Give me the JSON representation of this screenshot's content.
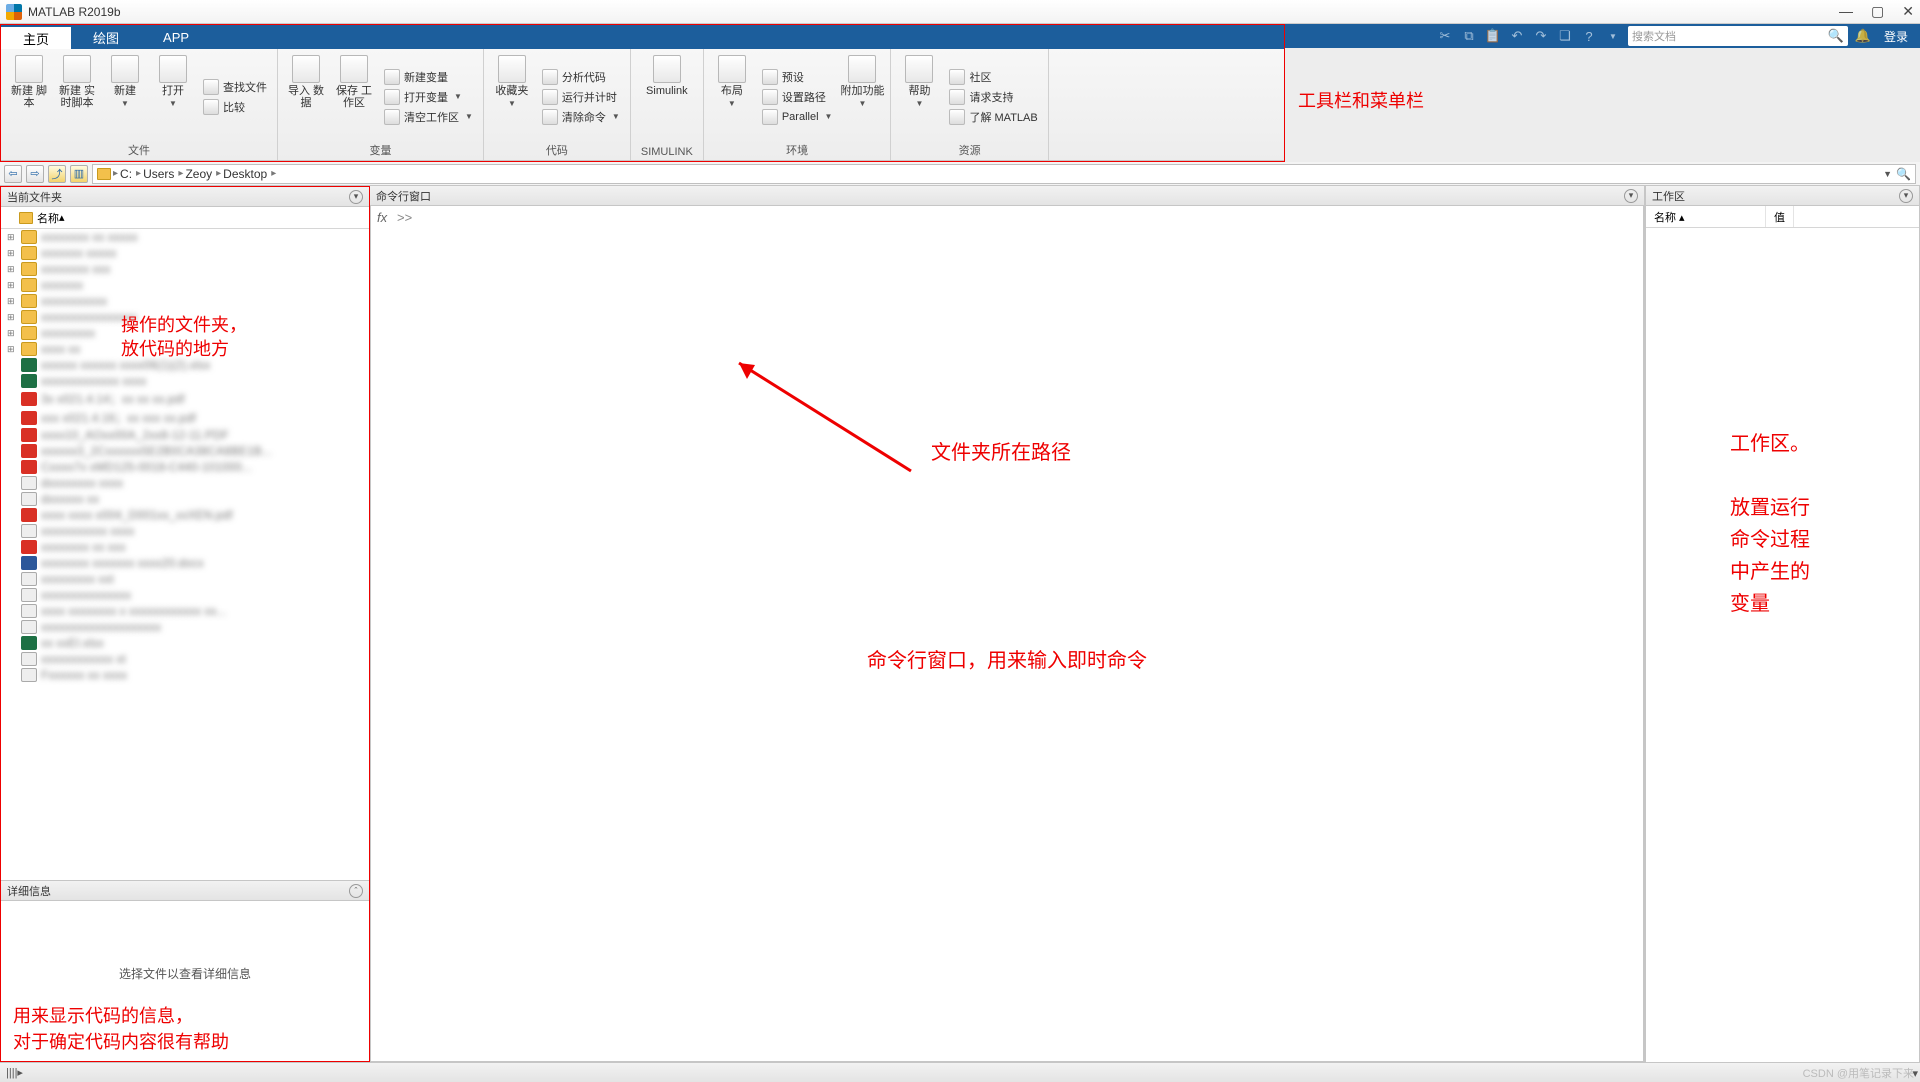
{
  "title": "MATLAB R2019b",
  "window": {
    "min": "—",
    "max": "▢",
    "close": "✕"
  },
  "tabs": [
    {
      "label": "主页",
      "active": true
    },
    {
      "label": "绘图",
      "active": false
    },
    {
      "label": "APP",
      "active": false
    }
  ],
  "search": {
    "placeholder": "搜索文档"
  },
  "login": "登录",
  "ribbon": {
    "groups": {
      "file": {
        "label": "文件",
        "items": {
          "newscript": "新建\n脚本",
          "newlive": "新建\n实时脚本",
          "new": "新建",
          "open": "打开",
          "findfiles": "查找文件",
          "compare": "比较"
        }
      },
      "variable": {
        "label": "变量",
        "items": {
          "import": "导入\n数据",
          "savews": "保存\n工作区",
          "newvar": "新建变量",
          "openvar": "打开变量",
          "clearws": "清空工作区"
        }
      },
      "code": {
        "label": "代码",
        "items": {
          "fav": "收藏夹",
          "analyze": "分析代码",
          "runtime": "运行并计时",
          "clearcmd": "清除命令"
        }
      },
      "simulink": {
        "label": "SIMULINK",
        "items": {
          "simulink": "Simulink"
        }
      },
      "env": {
        "label": "环境",
        "items": {
          "layout": "布局",
          "prefs": "预设",
          "setpath": "设置路径",
          "parallel": "Parallel",
          "addons": "附加功能"
        }
      },
      "resources": {
        "label": "资源",
        "items": {
          "help": "帮助",
          "community": "社区",
          "support": "请求支持",
          "learn": "了解 MATLAB"
        }
      }
    }
  },
  "anno": {
    "toolbar": "工具栏和菜单栏",
    "path": "文件夹所在路径",
    "folder": "操作的文件夹，\n放代码的地方",
    "cmd": "命令行窗口，用来输入即时命令",
    "ws": "工作区。\n\n放置运行\n命令过程\n中产生的\n变量",
    "details": "用来显示代码的信息，\n对于确定代码内容很有帮助"
  },
  "path": {
    "segments": [
      "C:",
      "Users",
      "Zeoy",
      "Desktop"
    ]
  },
  "panels": {
    "currentFolder": "当前文件夹",
    "commandWindow": "命令行窗口",
    "workspace": "工作区",
    "details": "详细信息",
    "nameCol": "名称",
    "valueCol": "值",
    "nameSort": "名称 ▴",
    "detailsMsg": "选择文件以查看详细信息"
  },
  "fx": "fx",
  "prompt": ">>",
  "files": [
    {
      "name": "xxxxxxxx xx xxxxx",
      "type": "folder",
      "exp": true
    },
    {
      "name": "xxxxxxx xxxxx",
      "type": "folder",
      "exp": true
    },
    {
      "name": "xxxxxxxx xxx",
      "type": "folder",
      "exp": true
    },
    {
      "name": "xxxxxxx",
      "type": "folder",
      "exp": true
    },
    {
      "name": "xxxxxxxxxxx",
      "type": "folder",
      "exp": true
    },
    {
      "name": "xxxxxxxxxxxxxxxx",
      "type": "folder",
      "exp": true
    },
    {
      "name": "xxxxxxxxx",
      "type": "folder",
      "exp": true
    },
    {
      "name": "xxxx xx",
      "type": "folder",
      "exp": true
    },
    {
      "name": "xxxxxx xxxxxx xxxx06(1)(2).xlsx",
      "type": "xlsx"
    },
    {
      "name": "xxxxxxxxxxxxx xxxx",
      "type": "xlsx"
    },
    {
      "name": "3x  x021.4.14；xx  xx xx.pdf",
      "type": "pdf"
    },
    {
      "name": "xxx  x021.4.16；xx xxx xx.pdf",
      "type": "pdf"
    },
    {
      "name": "xxxx10_AOxx00A_2xx8-12-11.PDF",
      "type": "pdf"
    },
    {
      "name": "xxxxxx3_2Cxxxxxx5E2B0CA38CA8BE1B...",
      "type": "pdf"
    },
    {
      "name": "Cxxxx7x  xMD125-0018-C440-101000...",
      "type": "pdf"
    },
    {
      "name": "dxxxxxxxx xxxx",
      "type": "generic"
    },
    {
      "name": "dxxxxxx xx",
      "type": "generic"
    },
    {
      "name": "xxxx xxxx x004_D001xx_xxXEN.pdf",
      "type": "pdf"
    },
    {
      "name": "xxxxxxxxxxx xxxx",
      "type": "generic"
    },
    {
      "name": "xxxxxxxx xx xxx",
      "type": "pdf"
    },
    {
      "name": "xxxxxxxx xxxxxxx xxxx20.docx",
      "type": "docx"
    },
    {
      "name": "xxxxxxxxx xxt",
      "type": "txt"
    },
    {
      "name": "xxxxxxxxxxxxxxx",
      "type": "generic"
    },
    {
      "name": "xxxx  xxxxxxxx x  xxxxxxxxxxxx xx...",
      "type": "generic"
    },
    {
      "name": "xxxxxxxxxxxxxxxxxxxx",
      "type": "generic"
    },
    {
      "name": "xx  xxEI.xlsx",
      "type": "xlsx"
    },
    {
      "name": "xxxxxxxxxxxx xt",
      "type": "txt"
    },
    {
      "name": "Fxxxxxx xx xxxx",
      "type": "generic"
    }
  ],
  "watermark": "CSDN @用笔记录下来",
  "statusbar": "||||▸"
}
